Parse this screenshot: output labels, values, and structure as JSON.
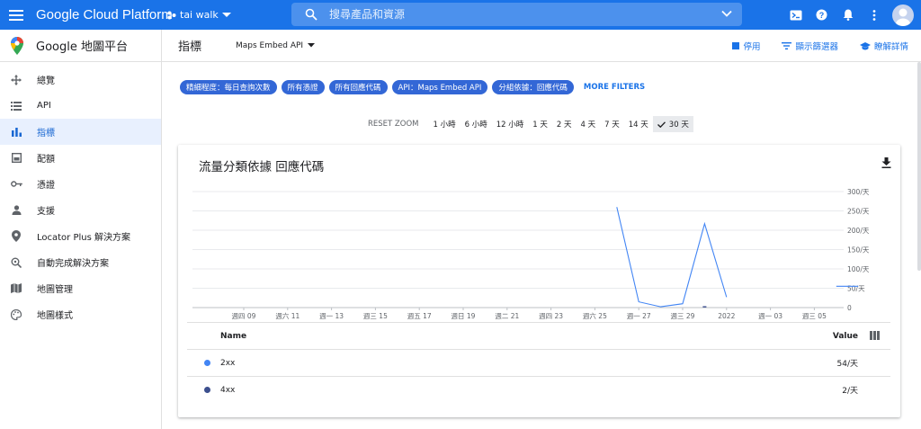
{
  "topbar": {
    "brand": "Google Cloud Platform",
    "project": "tai walk",
    "search_placeholder": "搜尋產品和資源"
  },
  "sidebar": {
    "title": "Google 地圖平台",
    "items": [
      {
        "label": "總覽",
        "icon": "move-icon"
      },
      {
        "label": "API",
        "icon": "list-icon"
      },
      {
        "label": "指標",
        "icon": "bar-chart-icon",
        "active": true
      },
      {
        "label": "配額",
        "icon": "quota-icon"
      },
      {
        "label": "憑證",
        "icon": "key-icon"
      },
      {
        "label": "支援",
        "icon": "person-icon"
      },
      {
        "label": "Locator Plus 解決方案",
        "icon": "map-pin-icon"
      },
      {
        "label": "自動完成解決方案",
        "icon": "search-location-icon"
      },
      {
        "label": "地圖管理",
        "icon": "map-icon"
      },
      {
        "label": "地圖樣式",
        "icon": "palette-icon"
      }
    ]
  },
  "header": {
    "page_title": "指標",
    "api_select": "Maps Embed API",
    "actions": {
      "disable": "停用",
      "filter": "顯示篩選器",
      "learn": "瞭解詳情"
    }
  },
  "filters": {
    "chips": [
      "精細程度：每日查詢次數",
      "所有憑證",
      "所有回應代碼",
      "API：Maps Embed API",
      "分組依據：回應代碼"
    ],
    "more": "MORE FILTERS"
  },
  "ranges": {
    "reset": "RESET ZOOM",
    "options": [
      "1 小時",
      "6 小時",
      "12 小時",
      "1 天",
      "2 天",
      "4 天",
      "7 天",
      "14 天",
      "30 天"
    ],
    "selected": "30 天"
  },
  "card": {
    "title": "流量分類依據 回應代碼",
    "table": {
      "col_name": "Name",
      "col_value": "Value",
      "rows": [
        {
          "name": "2xx",
          "value": "54/天",
          "color": "#4285f4"
        },
        {
          "name": "4xx",
          "value": "2/天",
          "color": "#3c4f8e"
        }
      ]
    }
  },
  "chart_data": {
    "type": "line",
    "ylim": [
      0,
      300
    ],
    "y_ticks": [
      "0",
      "50/天",
      "100/天",
      "150/天",
      "200/天",
      "250/天",
      "300/天"
    ],
    "x_ticks": [
      "週四 09",
      "週六 11",
      "週一 13",
      "週三 15",
      "週五 17",
      "週日 19",
      "週二 21",
      "週四 23",
      "週六 25",
      "週一 27",
      "週三 29",
      "2022",
      "週一 03",
      "週三 05"
    ],
    "series": [
      {
        "name": "2xx",
        "color": "#4285f4",
        "segments": [
          [
            {
              "x": "2021-12-26",
              "y": 260
            },
            {
              "x": "2021-12-27",
              "y": 15
            },
            {
              "x": "2021-12-28",
              "y": 2
            },
            {
              "x": "2021-12-29",
              "y": 10
            },
            {
              "x": "2021-12-30",
              "y": 217
            },
            {
              "x": "2021-12-31",
              "y": 27
            }
          ],
          [
            {
              "x": "2022-01-05",
              "y": 55
            },
            {
              "x": "2022-01-06",
              "y": 55
            }
          ]
        ]
      },
      {
        "name": "4xx",
        "color": "#3c4f8e",
        "segments": [
          [
            {
              "x": "2021-12-30",
              "y": 2
            }
          ]
        ]
      }
    ]
  }
}
